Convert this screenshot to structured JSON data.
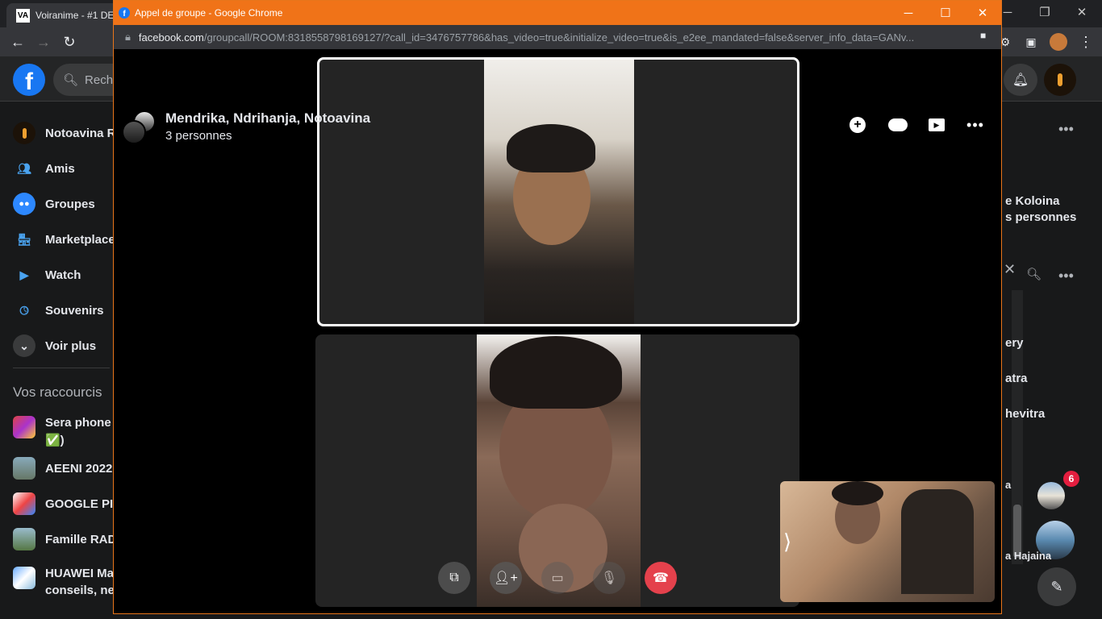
{
  "background": {
    "tab_title": "Voiranime - #1 DE",
    "search_placeholder": "Reche",
    "sidebar": [
      {
        "label": "Notoavina Ra",
        "icon": "profile-avatar"
      },
      {
        "label": "Amis",
        "icon": "friends-icon"
      },
      {
        "label": "Groupes",
        "icon": "groups-icon"
      },
      {
        "label": "Marketplace",
        "icon": "marketplace-icon"
      },
      {
        "label": "Watch",
        "icon": "watch-icon"
      },
      {
        "label": "Souvenirs",
        "icon": "memories-icon"
      },
      {
        "label": "Voir plus",
        "icon": "chevron-down-icon"
      }
    ],
    "shortcuts_heading": "Vos raccourcis",
    "shortcuts": [
      {
        "label": "Sera phone v",
        "label2": "✅)"
      },
      {
        "label": "AEENI 2022"
      },
      {
        "label": "GOOGLE PIX"
      },
      {
        "label": "Famille RADA"
      },
      {
        "label": "HUAWEI Mac",
        "label2": "conseils, new"
      }
    ],
    "right_texts": [
      "e Koloina",
      "s personnes",
      "ery",
      "atra",
      "hevitra",
      "a",
      "a Hajaina"
    ],
    "notification_badge": "6"
  },
  "popup": {
    "window_title": "Appel de groupe - Google Chrome",
    "url_domain": "facebook.com",
    "url_path": "/groupcall/ROOM:8318558798169127/?call_id=3476757786&has_video=true&initialize_video=true&is_e2ee_mandated=false&server_info_data=GANv...",
    "call": {
      "title": "Mendrika, Ndrihanja, Notoavina",
      "participants": "3 personnes"
    }
  },
  "colors": {
    "popup_titlebar": "#f07318",
    "fb_blue": "#1877f2",
    "end_call": "#e4414c"
  }
}
